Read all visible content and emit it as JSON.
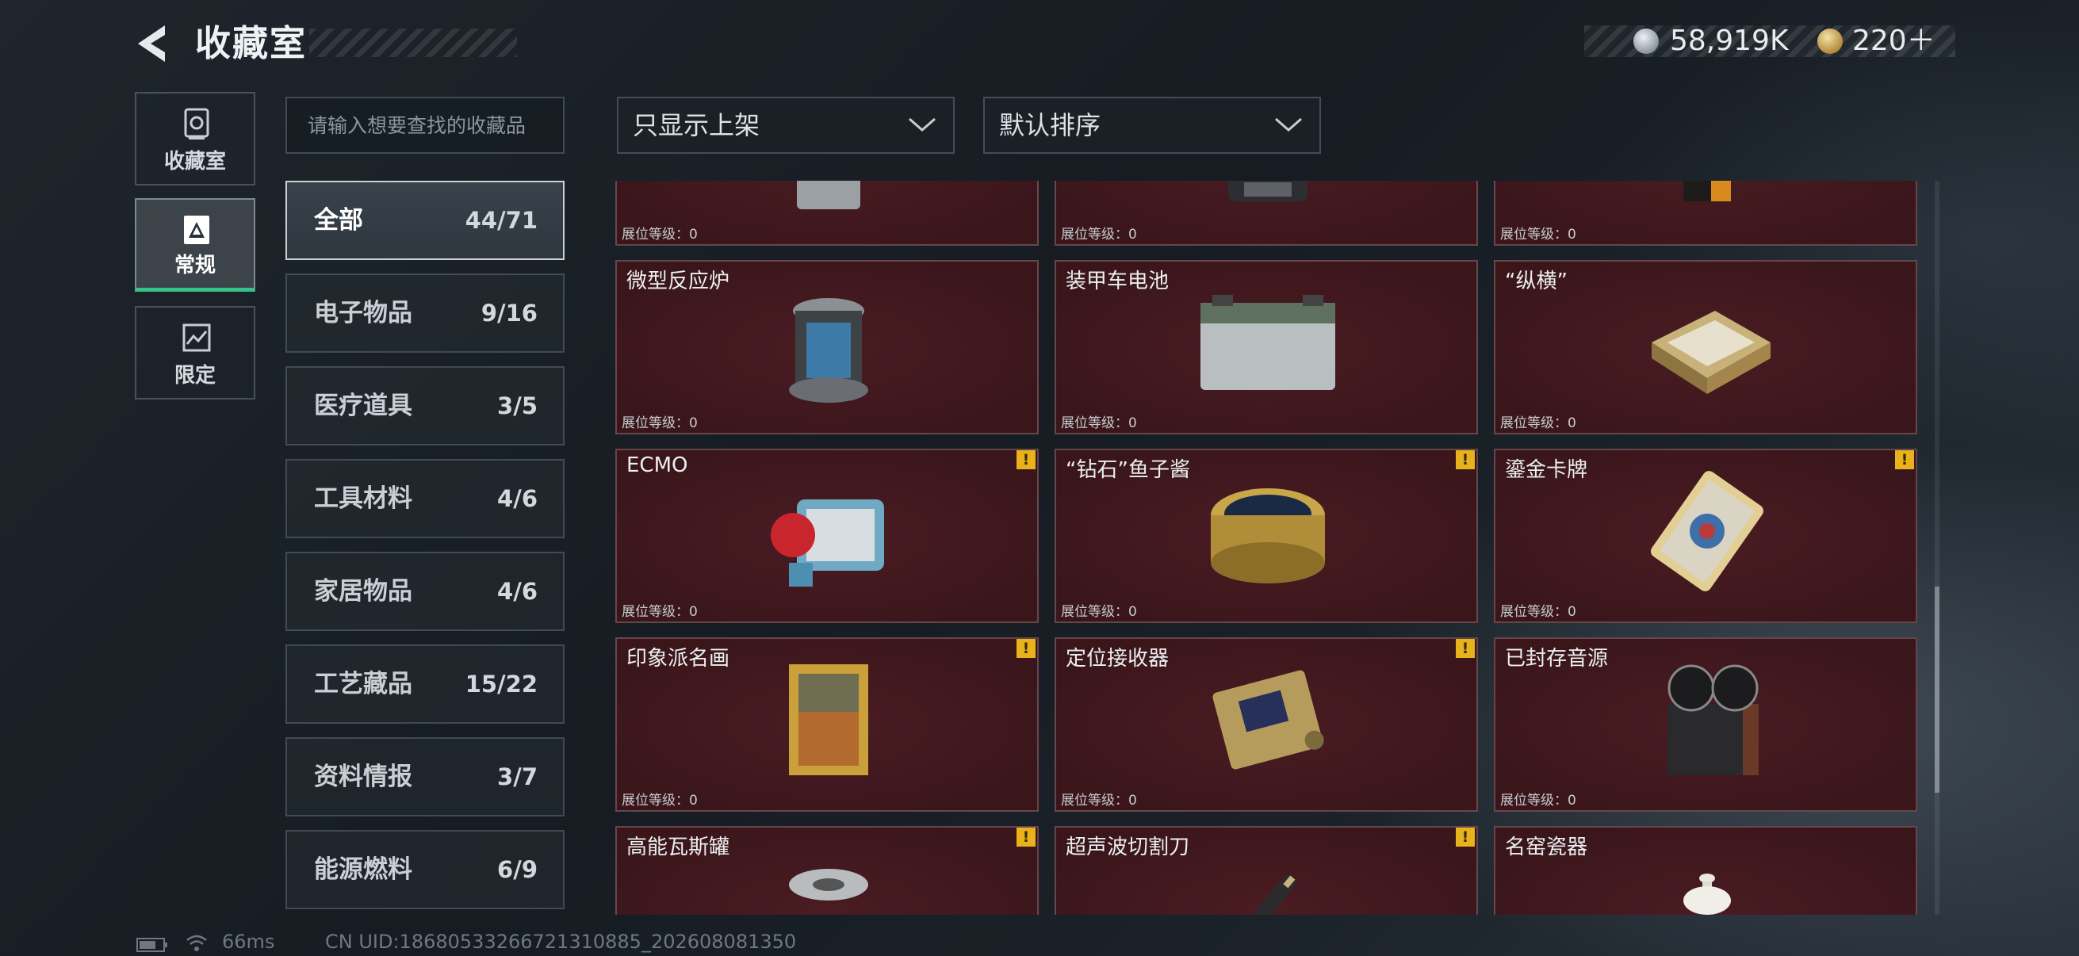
{
  "header": {
    "title": "收藏室",
    "silver_amount": "58,919K",
    "gold_amount": "220＋"
  },
  "side_tabs": [
    {
      "label": "收藏室",
      "icon": "vault-icon"
    },
    {
      "label": "常规",
      "icon": "regular-icon",
      "active": true
    },
    {
      "label": "限定",
      "icon": "limited-icon"
    }
  ],
  "search": {
    "placeholder": "请输入想要查找的收藏品"
  },
  "categories": [
    {
      "name": "全部",
      "count": "44/71",
      "active": true
    },
    {
      "name": "电子物品",
      "count": "9/16"
    },
    {
      "name": "医疗道具",
      "count": "3/5"
    },
    {
      "name": "工具材料",
      "count": "4/6"
    },
    {
      "name": "家居物品",
      "count": "4/6"
    },
    {
      "name": "工艺藏品",
      "count": "15/22"
    },
    {
      "name": "资料情报",
      "count": "3/7"
    },
    {
      "name": "能源燃料",
      "count": "6/9"
    }
  ],
  "filters": {
    "display": "只显示上架",
    "sort": "默认排序"
  },
  "level_label": "展位等级：0",
  "items": [
    {
      "name": "",
      "icon": "jerry-can-icon",
      "warn": false
    },
    {
      "name": "",
      "icon": "coffee-machine-icon",
      "warn": false
    },
    {
      "name": "",
      "icon": "coffee-bag-icon",
      "warn": false
    },
    {
      "name": "微型反应炉",
      "icon": "micro-reactor-icon",
      "warn": false
    },
    {
      "name": "装甲车电池",
      "icon": "armored-battery-icon",
      "warn": false
    },
    {
      "name": "“纵横”",
      "icon": "chess-box-icon",
      "warn": false
    },
    {
      "name": "ECMO",
      "icon": "ecmo-icon",
      "warn": true
    },
    {
      "name": "“钻石”鱼子酱",
      "icon": "caviar-tin-icon",
      "warn": true
    },
    {
      "name": "鎏金卡牌",
      "icon": "gilded-card-icon",
      "warn": true
    },
    {
      "name": "印象派名画",
      "icon": "painting-icon",
      "warn": true
    },
    {
      "name": "定位接收器",
      "icon": "locator-receiver-icon",
      "warn": true
    },
    {
      "name": "已封存音源",
      "icon": "reel-recorder-icon",
      "warn": false
    },
    {
      "name": "高能瓦斯罐",
      "icon": "gas-canister-icon",
      "warn": true
    },
    {
      "name": "超声波切割刀",
      "icon": "ultrasonic-cutter-icon",
      "warn": true
    },
    {
      "name": "名窑瓷器",
      "icon": "porcelain-vase-icon",
      "warn": false
    }
  ],
  "warn_symbol": "!",
  "status": {
    "ping": "66ms",
    "uid": "CN UID:1868053326672131088​5_202608081350"
  },
  "colors": {
    "card_bg": "#3a161b",
    "active_tab_accent": "#37c28a",
    "warn": "#e8b21c"
  }
}
